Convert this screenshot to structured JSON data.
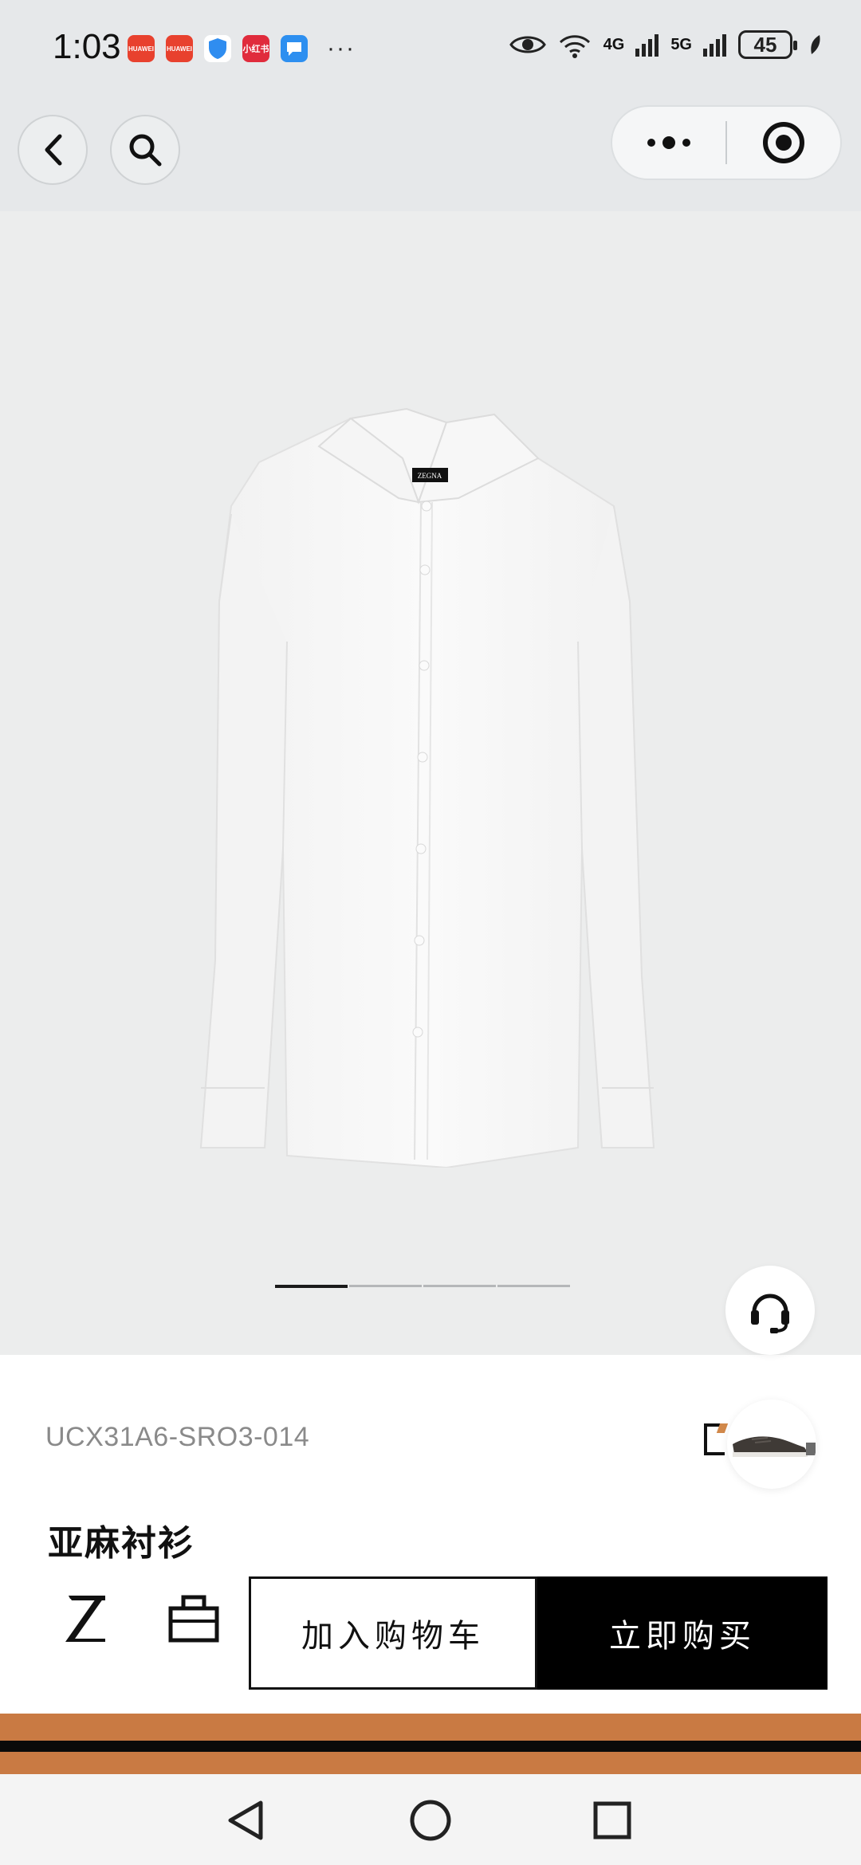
{
  "status_bar": {
    "time": "1:03",
    "apps": [
      {
        "name": "huawei-appgallery-icon",
        "label": "HUAWEI",
        "color": "#e8412e"
      },
      {
        "name": "huawei-appgallery-icon",
        "label": "HUAWEI",
        "color": "#e8412e"
      },
      {
        "name": "security-shield-icon",
        "label": "",
        "color": "#2f8df0"
      },
      {
        "name": "xiaohongshu-icon",
        "label": "小红书",
        "color": "#e02b3c"
      },
      {
        "name": "messaging-icon",
        "label": "",
        "color": "#2d8ff0"
      }
    ],
    "more": "···",
    "network_1": "4G",
    "network_2": "5G",
    "battery": "45"
  },
  "top_bar": {
    "back_icon": "chevron-left-icon",
    "search_icon": "search-icon",
    "more_icon": "more-dots-icon",
    "close_icon": "target-circle-icon"
  },
  "carousel": {
    "total": 4,
    "active": 0
  },
  "product": {
    "sku": "UCX31A6-SRO3-014",
    "title": "亚麻衬衫",
    "collar_label": "ZEGNA"
  },
  "actions": {
    "add_to_cart": "加入购物车",
    "buy_now": "立即购买"
  },
  "colors": {
    "accent_orange": "#c97a43",
    "black": "#000000",
    "hero_bg": "#eceded"
  }
}
